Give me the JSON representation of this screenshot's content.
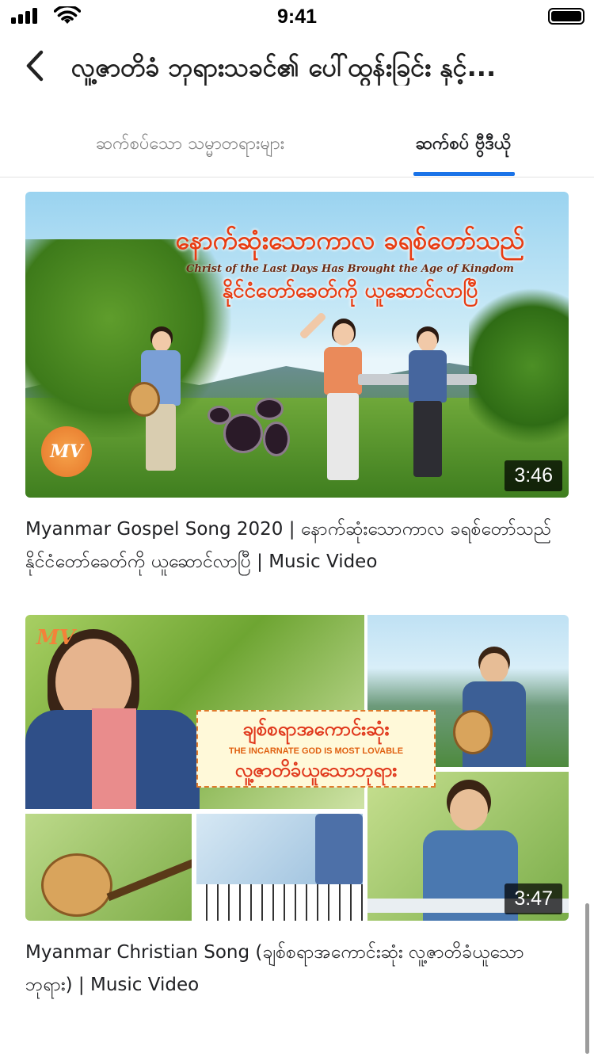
{
  "status_bar": {
    "time": "9:41",
    "icons": [
      "signal-icon",
      "wifi-icon",
      "battery-icon"
    ]
  },
  "header": {
    "back_icon": "chevron-left-icon",
    "title": "လူ့ဇာတိခံ ဘုရားသခင်၏ ပေါ်ထွန်းခြင်း နှင့်..."
  },
  "tabs": [
    {
      "label": "ဆက်စပ်သော သမ္မာတရားများ",
      "selected": false
    },
    {
      "label": "ဆက်စပ် ဗွီဒီယို",
      "selected": true
    }
  ],
  "accent_color": "#1a73e8",
  "videos": [
    {
      "title": "Myanmar Gospel Song 2020 | နောက်ဆုံးသောကာလ ခရစ်တော်သည် နိုင်ငံတော်ခေတ်ကို ယူဆောင်လာပြီ | Music Video",
      "duration": "3:46",
      "thumbnail": {
        "line1": "နောက်ဆုံးသောကာလ ခရစ်တော်သည်",
        "line2": "Christ of the Last Days Has Brought the Age of Kingdom",
        "line3": "နိုင်ငံတော်ခေတ်ကို ယူဆောင်လာပြီ",
        "logo": "MV"
      }
    },
    {
      "title": "Myanmar Christian Song (ချစ်စရာအကောင်းဆုံး လူ့ဇာတိခံယူသောဘုရား) | Music Video",
      "duration": "3:47",
      "thumbnail": {
        "line1": "ချစ်စရာအကောင်းဆုံး",
        "line2": "THE INCARNATE GOD IS MOST LOVABLE",
        "line3": "လူ့ဇာတိခံယူသောဘုရား",
        "logo": "MV"
      }
    }
  ]
}
